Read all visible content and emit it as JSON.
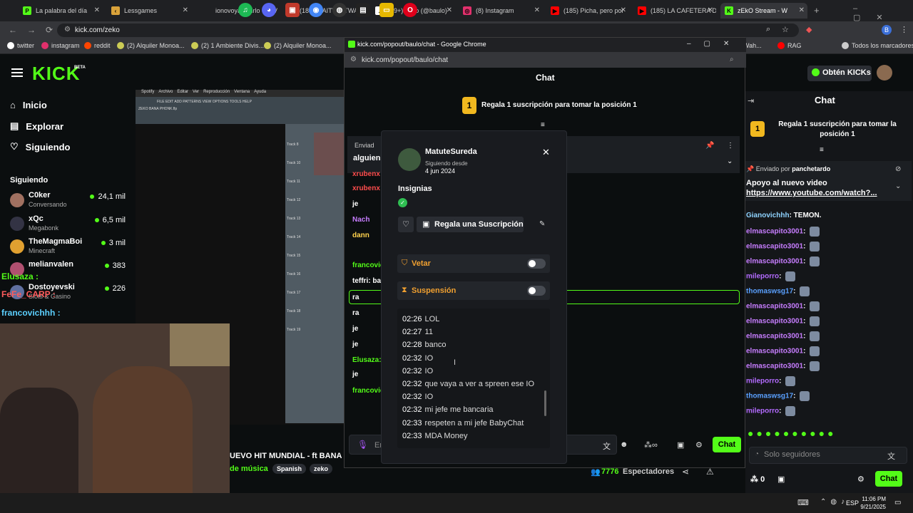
{
  "browser": {
    "tabs": [
      {
        "label": "La palabra del día",
        "color": "#53fc18",
        "glyph": "P",
        "active": false
      },
      {
        "label": "Lessgames",
        "color": "#d9a23a",
        "glyph": "‹",
        "active": false
      },
      {
        "label": "ionovoyadecirlo - 7TV",
        "color": "#1f2023",
        "glyph": "",
        "active": false
      },
      {
        "label": "(185) WAITWAITWAIT",
        "color": "#ff0000",
        "glyph": "▶",
        "active": false
      },
      {
        "label": "(99+)baulo (@baulo)",
        "color": "#ffffff",
        "glyph": "♪",
        "active": false
      },
      {
        "label": "(8) Instagram",
        "color": "#e1306c",
        "glyph": "◎",
        "active": false
      },
      {
        "label": "(185) Picha, pero por",
        "color": "#ff0000",
        "glyph": "▶",
        "active": false
      },
      {
        "label": "(185) LA CAFETERA D",
        "color": "#ff0000",
        "glyph": "▶",
        "active": false
      },
      {
        "label": "zEkO Stream - W",
        "color": "#53fc18",
        "glyph": "K",
        "active": true
      }
    ],
    "url": "kick.com/zeko",
    "bookmarks": [
      {
        "label": "twitter",
        "color": "#ffffff"
      },
      {
        "label": "instagram",
        "color": "#e1306c"
      },
      {
        "label": "reddit",
        "color": "#ff4500"
      },
      {
        "label": "(2) Alquiler Monoa...",
        "color": "#cccc55"
      },
      {
        "label": "(2) 1 Ambiente Divis...",
        "color": "#cccc55"
      },
      {
        "label": "(2) Alquiler Monoa...",
        "color": "#cccc55"
      },
      {
        "label": "Wah...",
        "color": "#cccccc"
      },
      {
        "label": "RAG",
        "color": "#ff0000"
      },
      {
        "label": "Todos los marcadores",
        "color": "#cccccc"
      }
    ]
  },
  "kick": {
    "logo": "KICK",
    "logo_beta": "BETA",
    "get_kicks": "Obtén KICKs",
    "nav": [
      "Inicio",
      "Explorar",
      "Siguiendo"
    ],
    "following_title": "Siguiendo",
    "channels": [
      {
        "name": "C0ker",
        "sub": "Conversando",
        "viewers": "24,1 mil"
      },
      {
        "name": "xQc",
        "sub": "Megabonk",
        "viewers": "6,5 mil"
      },
      {
        "name": "TheMagmaBoi",
        "sub": "Minecraft",
        "viewers": "3 mil"
      },
      {
        "name": "melianvalen",
        "sub": "",
        "viewers": "383"
      },
      {
        "name": "Dostoyevski",
        "sub": "Slots & Casino",
        "viewers": "226"
      }
    ],
    "overlay_chat": [
      "Elusaza :",
      "FeFe_CARP :",
      "francovichhh :"
    ],
    "stream_title": "UEVO HIT MUNDIAL - ft BANA M",
    "category": "de música",
    "tags": [
      "Spanish",
      "zeko"
    ],
    "viewers": "7776",
    "viewers_label": "Espectadores"
  },
  "right_chat": {
    "title": "Chat",
    "gift_banner": "Regala 1 suscripción para tomar la posición 1",
    "gift_rank": "1",
    "pinned_by": "Enviado por",
    "pinned_user": "panchetardo",
    "pinned_text": "Apoyo al nuevo video",
    "pinned_link": "https://www.youtube.com/watch?...",
    "messages": [
      {
        "user": "Gianovichhh",
        "text": "TEMON.",
        "color": "#8fd3ff"
      },
      {
        "user": "elmascapito3001",
        "text": "",
        "color": "#c77dff"
      },
      {
        "user": "elmascapito3001",
        "text": "",
        "color": "#c77dff"
      },
      {
        "user": "elmascapito3001",
        "text": "",
        "color": "#c77dff"
      },
      {
        "user": "mileporro",
        "text": "",
        "color": "#b36bff"
      },
      {
        "user": "thomaswsg17",
        "text": "",
        "color": "#5aa0ff"
      },
      {
        "user": "elmascapito3001",
        "text": "",
        "color": "#c77dff"
      },
      {
        "user": "elmascapito3001",
        "text": "",
        "color": "#c77dff"
      },
      {
        "user": "elmascapito3001",
        "text": "",
        "color": "#c77dff"
      },
      {
        "user": "elmascapito3001",
        "text": "",
        "color": "#c77dff"
      },
      {
        "user": "elmascapito3001",
        "text": "",
        "color": "#c77dff"
      },
      {
        "user": "mileporro",
        "text": "",
        "color": "#b36bff"
      },
      {
        "user": "thomaswsg17",
        "text": "",
        "color": "#5aa0ff"
      },
      {
        "user": "mileporro",
        "text": "",
        "color": "#b36bff"
      }
    ],
    "input_placeholder": "Solo seguidores",
    "kicks": "0",
    "send_label": "Chat"
  },
  "popout": {
    "window_title": "kick.com/popout/baulo/chat - Google Chrome",
    "url": "kick.com/popout/baulo/chat",
    "chat_title": "Chat",
    "gift_banner": "Regala 1 suscripción para tomar la posición 1",
    "gift_rank": "1",
    "pinned_prefix": "Enviad",
    "pinned_text": "alguien",
    "chat_lines": [
      {
        "user": "xrubenx",
        "color": "#ff4d4d"
      },
      {
        "user": "xrubenx",
        "color": "#ff4d4d"
      },
      {
        "user": "je",
        "color": "#ffffff"
      },
      {
        "user": "Nach",
        "color": "#c77dff"
      },
      {
        "user": "dann",
        "color": "#ffd24d"
      },
      {
        "user": "",
        "color": "#ffffff"
      },
      {
        "user": "francovic",
        "color": "#53fc18"
      },
      {
        "user": "teffri: ba",
        "color": "#ffffff"
      },
      {
        "user": "ra",
        "color": "#ffffff"
      },
      {
        "user": "ra",
        "color": "#ffffff"
      },
      {
        "user": "je",
        "color": "#ffffff"
      },
      {
        "user": "je",
        "color": "#ffffff"
      },
      {
        "user": "Elusaza:",
        "color": "#53fc18"
      },
      {
        "user": "je",
        "color": "#ffffff"
      },
      {
        "user": "francovic",
        "color": "#53fc18"
      }
    ],
    "input_placeholder": "En",
    "send_label": "Chat"
  },
  "card": {
    "username": "MatuteSureda",
    "following_label": "Siguiendo desde",
    "following_date": "4 jun 2024",
    "badges_label": "Insignias",
    "gift_button": "Regala una Suscripción",
    "veto_label": "Vetar",
    "suspend_label": "Suspensión",
    "history": [
      {
        "time": "02:26",
        "text": "LOL"
      },
      {
        "time": "02:27",
        "text": "11"
      },
      {
        "time": "02:28",
        "text": "banco"
      },
      {
        "time": "02:32",
        "text": "IO"
      },
      {
        "time": "02:32",
        "text": "IO"
      },
      {
        "time": "02:32",
        "text": "que vaya a ver a spreen ese IO"
      },
      {
        "time": "02:32",
        "text": "IO"
      },
      {
        "time": "02:32",
        "text": "mi jefe me bancaria"
      },
      {
        "time": "02:33",
        "text": "respeten a mi jefe BabyChat"
      },
      {
        "time": "02:33",
        "text": "MDA Money"
      }
    ]
  },
  "video": {
    "menu": [
      "Spotify",
      "Archivo",
      "Editar",
      "Ver",
      "Reproducción",
      "Ventana",
      "Ayuda"
    ],
    "daw_menu": "FILE EDIT ADD PATTERNS VIEW OPTIONS TOOLS HELP",
    "project": "ZEKO BANA PHONK.flp",
    "tracks": [
      "Track 8",
      "Track 10",
      "Track 11",
      "Track 12",
      "Track 13",
      "Track 14",
      "Track 15",
      "Track 16",
      "Track 17",
      "Track 18",
      "Track 19"
    ]
  },
  "taskbar": {
    "language": "ESP",
    "time": "11:06 PM",
    "date": "9/21/2025"
  }
}
